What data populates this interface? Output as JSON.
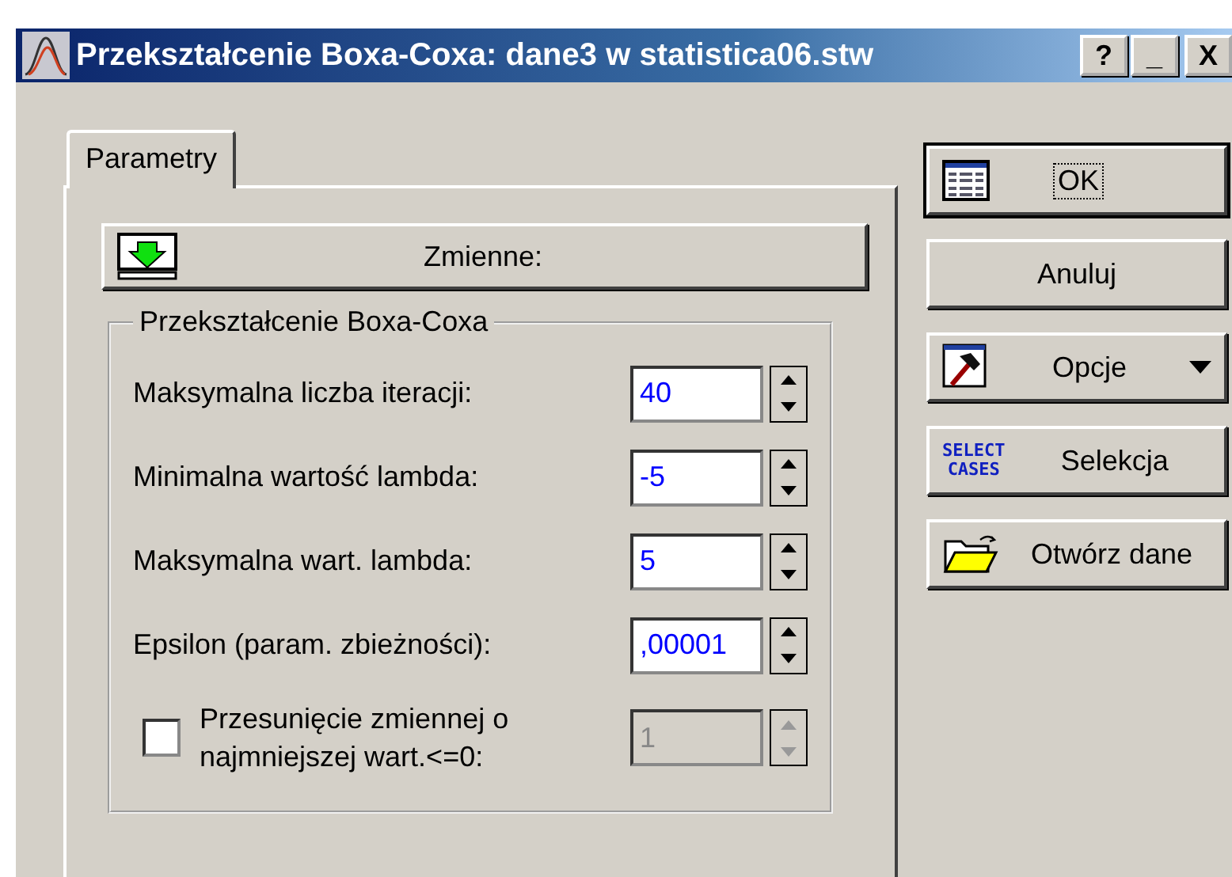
{
  "window": {
    "title": "Przekształcenie Boxa-Coxa: dane3 w statistica06.stw",
    "controls": [
      {
        "kind": "help",
        "label": "?"
      },
      {
        "kind": "minimize",
        "label": "_"
      },
      {
        "kind": "close",
        "label": "X"
      }
    ]
  },
  "tabs": [
    {
      "label": "Parametry",
      "selected": true
    }
  ],
  "variables_button": {
    "label": "Zmienne:"
  },
  "group": {
    "title": "Przekształcenie Boxa-Coxa",
    "fields": [
      {
        "label": "Maksymalna liczba iteracji:",
        "value": "40",
        "disabled": false
      },
      {
        "label": "Minimalna wartość lambda:",
        "value": "-5",
        "disabled": false
      },
      {
        "label": "Maksymalna wart. lambda:",
        "value": "5",
        "disabled": false
      },
      {
        "label": "Epsilon (param. zbieżności):",
        "value": ",00001",
        "disabled": false
      }
    ],
    "shift": {
      "label_lines": [
        "Przesunięcie zmiennej o",
        "najmniejszej wart.<=0:"
      ],
      "checked": false,
      "value": "1",
      "disabled": true
    }
  },
  "buttons": [
    {
      "kind": "ok",
      "label": "OK",
      "focused": true
    },
    {
      "kind": "cancel",
      "label": "Anuluj",
      "focused": false
    },
    {
      "kind": "options",
      "label": "Opcje",
      "focused": false
    },
    {
      "kind": "select",
      "label": "Selekcja",
      "icon_text": [
        "SELECT",
        "CASES"
      ],
      "focused": false
    },
    {
      "kind": "open",
      "label": "Otwórz dane",
      "focused": false
    }
  ]
}
